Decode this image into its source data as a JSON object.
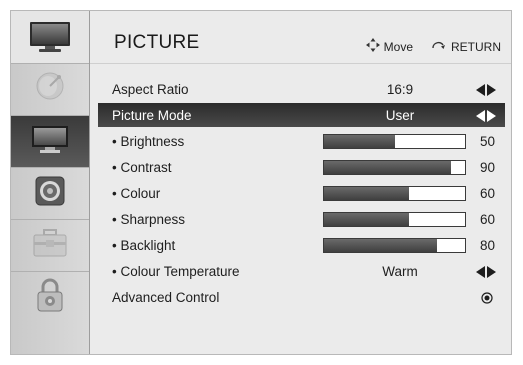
{
  "menu": {
    "title": "PICTURE",
    "hints": {
      "move_label": "Move",
      "return_label": "RETURN"
    }
  },
  "sidebar": {
    "items": [
      {
        "name": "tv-menu-icon",
        "active": false
      },
      {
        "name": "satellite-dish-icon",
        "active": false
      },
      {
        "name": "monitor-icon",
        "active": true
      },
      {
        "name": "speaker-icon",
        "active": false
      },
      {
        "name": "toolbox-icon",
        "active": false
      },
      {
        "name": "padlock-icon",
        "active": false
      }
    ]
  },
  "settings": {
    "aspect_ratio": {
      "label": "Aspect Ratio",
      "value": "16:9"
    },
    "picture_mode": {
      "label": "Picture Mode",
      "value": "User"
    },
    "brightness": {
      "label": "• Brightness",
      "value": 50,
      "max": 100
    },
    "contrast": {
      "label": "• Contrast",
      "value": 90,
      "max": 100
    },
    "colour": {
      "label": "• Colour",
      "value": 60,
      "max": 100
    },
    "sharpness": {
      "label": "• Sharpness",
      "value": 60,
      "max": 100
    },
    "backlight": {
      "label": "• Backlight",
      "value": 80,
      "max": 100
    },
    "colour_temperature": {
      "label": "• Colour Temperature",
      "value": "Warm"
    },
    "advanced_control": {
      "label": "Advanced Control"
    }
  },
  "colors": {
    "selected_row": "#2b2b2b",
    "bar_fill": "#4a4a4a",
    "background": "#ebebeb"
  }
}
